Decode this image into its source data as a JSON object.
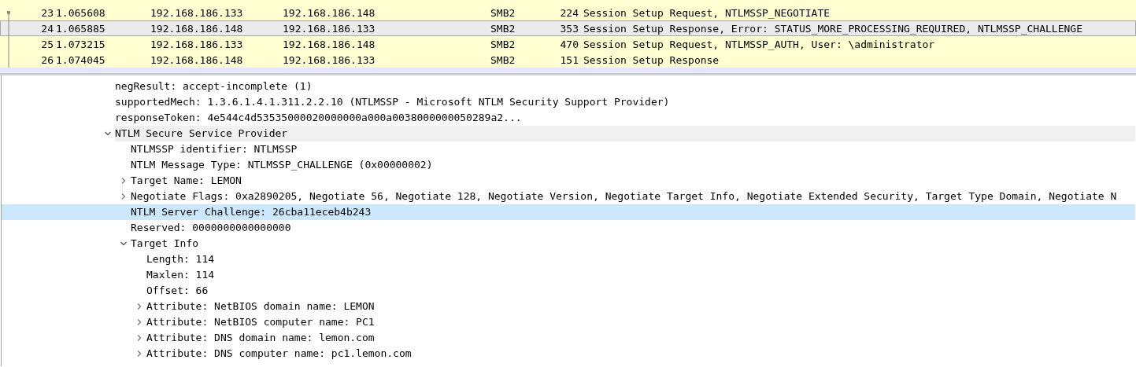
{
  "packet_list": {
    "rows": [
      {
        "no": "23",
        "time": "1.065608",
        "source": "192.168.186.133",
        "destination": "192.168.186.148",
        "protocol": "SMB2",
        "length": "224",
        "info": "Session Setup Request, NTLMSSP_NEGOTIATE",
        "selected": false
      },
      {
        "no": "24",
        "time": "1.065885",
        "source": "192.168.186.148",
        "destination": "192.168.186.133",
        "protocol": "SMB2",
        "length": "353",
        "info": "Session Setup Response, Error: STATUS_MORE_PROCESSING_REQUIRED, NTLMSSP_CHALLENGE",
        "selected": true
      },
      {
        "no": "25",
        "time": "1.073215",
        "source": "192.168.186.133",
        "destination": "192.168.186.148",
        "protocol": "SMB2",
        "length": "470",
        "info": "Session Setup Request, NTLMSSP_AUTH, User: \\administrator",
        "selected": false
      },
      {
        "no": "26",
        "time": "1.074045",
        "source": "192.168.186.148",
        "destination": "192.168.186.133",
        "protocol": "SMB2",
        "length": "151",
        "info": "Session Setup Response",
        "selected": false
      }
    ]
  },
  "packet_details": {
    "items": [
      {
        "label": "negResult: accept-incomplete (1)",
        "kind": "leaf",
        "selected": false
      },
      {
        "label": "supportedMech: 1.3.6.1.4.1.311.2.2.10 (NTLMSSP - Microsoft NTLM Security Support Provider)",
        "kind": "leaf",
        "selected": false
      },
      {
        "label": "responseToken: 4e544c4d53535000020000000a000a0038000000050289a2...",
        "kind": "leaf",
        "selected": false
      },
      {
        "label": "NTLM Secure Service Provider",
        "kind": "branch",
        "expanded": true,
        "selected": false,
        "hovered": true,
        "children": [
          {
            "label": "NTLMSSP identifier: NTLMSSP",
            "kind": "leaf",
            "selected": false
          },
          {
            "label": "NTLM Message Type: NTLMSSP_CHALLENGE (0x00000002)",
            "kind": "leaf",
            "selected": false
          },
          {
            "label": "Target Name: LEMON",
            "kind": "branch",
            "expanded": false,
            "selected": false
          },
          {
            "label": "Negotiate Flags: 0xa2890205, Negotiate 56, Negotiate 128, Negotiate Version, Negotiate Target Info, Negotiate Extended Security, Target Type Domain, Negotiate N",
            "kind": "branch",
            "expanded": false,
            "selected": false
          },
          {
            "label": "NTLM Server Challenge: 26cba11eceb4b243",
            "kind": "leaf",
            "selected": true
          },
          {
            "label": "Reserved: 0000000000000000",
            "kind": "leaf",
            "selected": false
          },
          {
            "label": "Target Info",
            "kind": "branch",
            "expanded": true,
            "selected": false,
            "children": [
              {
                "label": "Length: 114",
                "kind": "leaf",
                "selected": false
              },
              {
                "label": "Maxlen: 114",
                "kind": "leaf",
                "selected": false
              },
              {
                "label": "Offset: 66",
                "kind": "leaf",
                "selected": false
              },
              {
                "label": "Attribute: NetBIOS domain name: LEMON",
                "kind": "branch",
                "expanded": false,
                "selected": false
              },
              {
                "label": "Attribute: NetBIOS computer name: PC1",
                "kind": "branch",
                "expanded": false,
                "selected": false
              },
              {
                "label": "Attribute: DNS domain name: lemon.com",
                "kind": "branch",
                "expanded": false,
                "selected": false
              },
              {
                "label": "Attribute: DNS computer name: pc1.lemon.com",
                "kind": "branch",
                "expanded": false,
                "selected": false
              }
            ]
          }
        ]
      }
    ]
  }
}
